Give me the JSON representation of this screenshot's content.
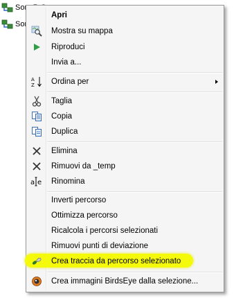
{
  "background_tree": [
    {
      "text": "Som  R  C"
    },
    {
      "text": "Som"
    }
  ],
  "menu": {
    "open": "Apri",
    "show_on_map": "Mostra su mappa",
    "play": "Riproduci",
    "send_to": "Invia a...",
    "sort_by": "Ordina per",
    "cut": "Taglia",
    "copy": "Copia",
    "duplicate": "Duplica",
    "delete": "Elimina",
    "remove_from": "Rimuovi da _temp",
    "rename": "Rinomina",
    "invert_route": "Inverti percorso",
    "optimize_route": "Ottimizza percorso",
    "recalc_routes": "Ricalcola i percorsi selezionati",
    "remove_waypoints": "Rimuovi punti di deviazione",
    "create_track": "Crea traccia da percorso selezionato",
    "create_birdseye": "Crea immagini BirdsEye dalla selezione..."
  },
  "colors": {
    "highlight": "#f5f90a",
    "play_green": "#2ea043"
  },
  "icons": {
    "show_on_map": "map-magnifier-icon",
    "play": "play-icon",
    "sort_by": "sort-az-icon",
    "cut": "scissors-icon",
    "copy": "copy-icon",
    "duplicate": "duplicate-icon",
    "delete": "x-icon",
    "remove_from": "x-icon",
    "rename": "rename-icon",
    "create_track": "track-icon",
    "create_birdseye": "birdseye-icon"
  }
}
